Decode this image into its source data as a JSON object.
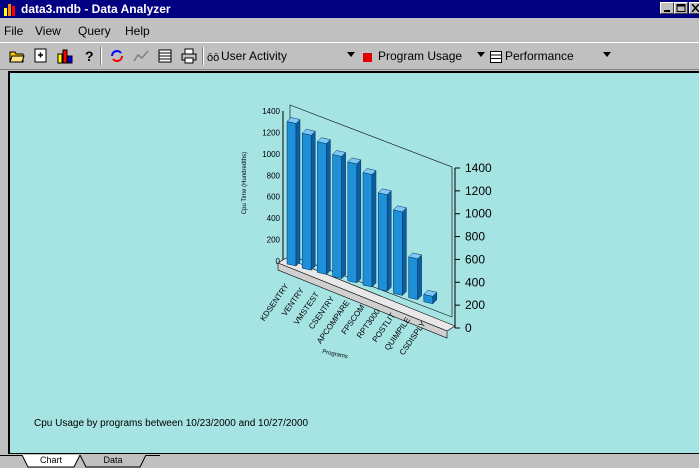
{
  "window": {
    "title": "data3.mdb - Data Analyzer"
  },
  "menu": {
    "items": [
      "File",
      "View",
      "Query",
      "Help"
    ]
  },
  "toolbar": {
    "user_activity": "User Activity",
    "program_usage": "Program Usage",
    "performance": "Performance"
  },
  "chart": {
    "caption": "Cpu Usage by programs between 10/23/2000 and 10/27/2000"
  },
  "chart_data": {
    "type": "bar",
    "title": "",
    "ylabel": "Cpu Time (Hundredths)",
    "xlabel": "Programs",
    "ylim": [
      0,
      1400
    ],
    "y_ticks": [
      "0",
      "200",
      "400",
      "600",
      "800",
      "1000",
      "1200",
      "1400"
    ],
    "back_y_ticks": [
      "0",
      "200",
      "400",
      "600",
      "800",
      "1000",
      "1200",
      "1400"
    ],
    "categories": [
      "KDSENTRY",
      "VENTRY",
      "VMSTEST",
      "CSENTRY",
      "APCOMPARE",
      "FPSCOM",
      "RPT3000",
      "POSTLIT",
      "QUIMPILE",
      "CSDISPLY"
    ],
    "values": [
      1330,
      1260,
      1220,
      1140,
      1110,
      1050,
      900,
      780,
      380,
      70
    ],
    "color": "#1e90d8"
  },
  "tabs": {
    "items": [
      "Chart",
      "Data"
    ]
  }
}
